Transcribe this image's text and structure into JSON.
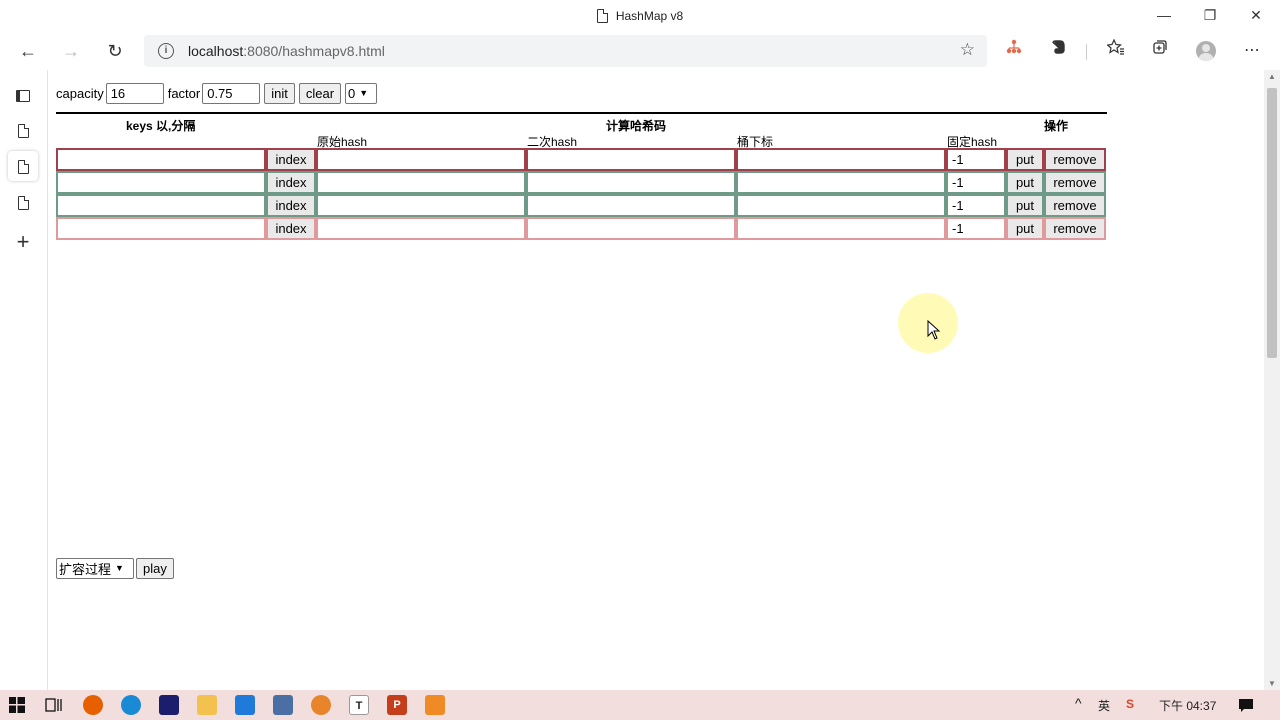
{
  "window": {
    "title": "HashMap v8",
    "minimize": "—",
    "restore": "❐",
    "close": "✕"
  },
  "browser": {
    "url_host": "localhost",
    "url_rest": ":8080/hashmapv8.html",
    "back_glyph": "←",
    "forward_glyph": "→",
    "refresh_glyph": "↻",
    "info_glyph": "i",
    "fav_glyph": "☆",
    "more_glyph": "⋯"
  },
  "controls": {
    "capacity_label": "capacity",
    "capacity_value": "16",
    "factor_label": "factor",
    "factor_value": "0.75",
    "init_label": "init",
    "clear_label": "clear",
    "select_value": "0"
  },
  "table": {
    "header": {
      "keys": "keys 以,分隔",
      "compute": "计算哈希码",
      "ops": "操作",
      "raw_hash": "原始hash",
      "second_hash": "二次hash",
      "bucket_index": "桶下标",
      "fixed_hash": "固定hash"
    },
    "rows": [
      {
        "index_label": "index",
        "fixed_value": "-1",
        "put_label": "put",
        "remove_label": "remove",
        "color": "#a0404a"
      },
      {
        "index_label": "index",
        "fixed_value": "-1",
        "put_label": "put",
        "remove_label": "remove",
        "color": "#6e9a87"
      },
      {
        "index_label": "index",
        "fixed_value": "-1",
        "put_label": "put",
        "remove_label": "remove",
        "color": "#6e9a87"
      },
      {
        "index_label": "index",
        "fixed_value": "-1",
        "put_label": "put",
        "remove_label": "remove",
        "color": "#e09a9c"
      }
    ]
  },
  "bottom": {
    "select_value": "扩容过程",
    "play_label": "play"
  },
  "taskbar": {
    "time": "下午 04:37",
    "ime": "英"
  },
  "colors": {
    "row_red": "#a0404a",
    "row_green": "#6e9a87",
    "row_pink": "#e09a9c"
  }
}
